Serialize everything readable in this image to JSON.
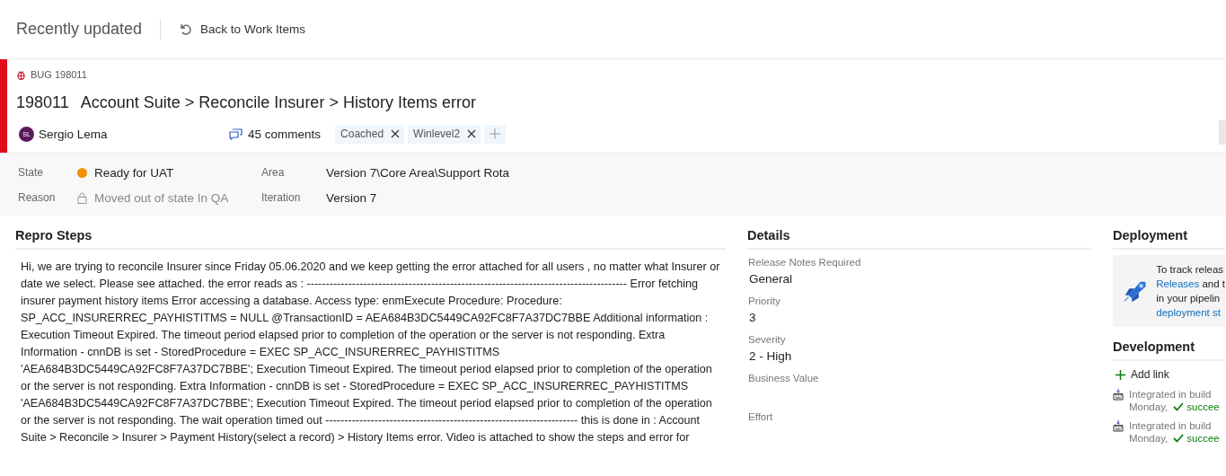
{
  "top_bar": {
    "title": "Recently updated",
    "back_link": "Back to Work Items"
  },
  "work_item": {
    "type_label": "BUG 198011",
    "id": "198011",
    "title": "Account Suite > Reconcile Insurer > History Items error",
    "assigned_to": {
      "initials": "SL",
      "name": "Sergio Lema"
    },
    "comments": "45 comments",
    "tags": [
      {
        "label": "Coached"
      },
      {
        "label": "Winlevel2"
      }
    ]
  },
  "fields": [
    {
      "label": "State",
      "value": "Ready for UAT",
      "kind": "state",
      "color": "#f29000"
    },
    {
      "label": "Area",
      "value": "Version 7\\Core Area\\Support Rota",
      "kind": "text"
    },
    {
      "label": "Reason",
      "value": "Moved out of state In QA",
      "kind": "locked"
    },
    {
      "label": "Iteration",
      "value": "Version 7",
      "kind": "text"
    }
  ],
  "repro_steps": {
    "heading": "Repro Steps",
    "text": "Hi, we are trying to reconcile Insurer since Friday 05.06.2020 and we keep getting the error attached for all users , no matter what Insurer or date we select. Please see attached. the error reads as : ------------------------------------------------------------------------------------- Error fetching insurer payment history items Error accessing a database. Access type: enmExecute Procedure: Procedure: SP_ACC_INSURERREC_PAYHISTITMS = NULL @TransactionID = AEA684B3DC5449CA92FC8F7A37DC7BBE Additional information : Execution Timeout Expired. The timeout period elapsed prior to completion of the operation or the server is not responding. Extra Information - cnnDB is set - StoredProcedure = EXEC SP_ACC_INSURERREC_PAYHISTITMS 'AEA684B3DC5449CA92FC8F7A37DC7BBE'; Execution Timeout Expired. The timeout period elapsed prior to completion of the operation or the server is not responding. Extra Information - cnnDB is set - StoredProcedure = EXEC SP_ACC_INSURERREC_PAYHISTITMS 'AEA684B3DC5449CA92FC8F7A37DC7BBE'; Execution Timeout Expired. The timeout period elapsed prior to completion of the operation or the server is not responding. The wait operation timed out ------------------------------------------------------------------- this is done in : Account Suite > Reconcile > Insurer > Payment History(select a record) > History Items error. Video is attached to show the steps and error for"
  },
  "details": {
    "heading": "Details",
    "fields": [
      {
        "label": "Release Notes Required",
        "value": "General"
      },
      {
        "label": "Priority",
        "value": "3"
      },
      {
        "label": "Severity",
        "value": "2 - High"
      },
      {
        "label": "Business Value"
      },
      {
        "label": "Effort"
      }
    ]
  },
  "deployment": {
    "heading": "Deployment",
    "message": [
      [
        {
          "text": "To track releas",
          "link": false
        }
      ],
      [
        {
          "text": "Releases",
          "link": true
        },
        {
          "text": " and t",
          "link": false
        }
      ],
      [
        {
          "text": "in your pipelin",
          "link": false
        }
      ],
      [
        {
          "text": "deployment st",
          "link": true
        }
      ]
    ]
  },
  "development": {
    "heading": "Development",
    "add_link": "Add link",
    "builds": [
      {
        "title": "Integrated in build",
        "day": "Monday,",
        "status": "succee"
      },
      {
        "title": "Integrated in build",
        "day": "Monday,",
        "status": "succee"
      }
    ]
  }
}
